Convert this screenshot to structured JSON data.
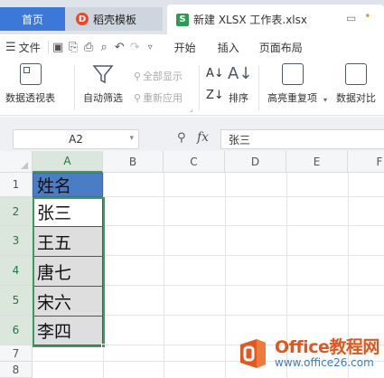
{
  "tabs": {
    "home": "首页",
    "templates": "稻壳模板",
    "file": "新建 XLSX 工作表.xlsx"
  },
  "menu": {
    "file": "文件",
    "start": "开始",
    "insert": "插入",
    "page_layout": "页面布局"
  },
  "ribbon": {
    "pivot": "数据透视表",
    "autofilter": "自动筛选",
    "show_all": "全部显示",
    "reapply": "重新应用",
    "sort": "排序",
    "highlight_dup": "高亮重复项",
    "compare": "数据对比"
  },
  "formula_bar": {
    "cell_ref": "A2",
    "fx": "fx",
    "value": "张三"
  },
  "columns": [
    "A",
    "B",
    "C",
    "D",
    "E",
    "F"
  ],
  "rows": [
    "1",
    "2",
    "3",
    "4",
    "5",
    "6",
    "7",
    "8"
  ],
  "cells": {
    "A1": "姓名",
    "A2": "张三",
    "A3": "王五",
    "A4": "唐七",
    "A5": "宋六",
    "A6": "李四"
  },
  "watermark": {
    "title": "Office教程网",
    "url": "www.office26.com"
  },
  "colors": {
    "accent_blue": "#3b78d8",
    "selection_green": "#3f9a5c",
    "header_fill": "#4a7dc6"
  }
}
